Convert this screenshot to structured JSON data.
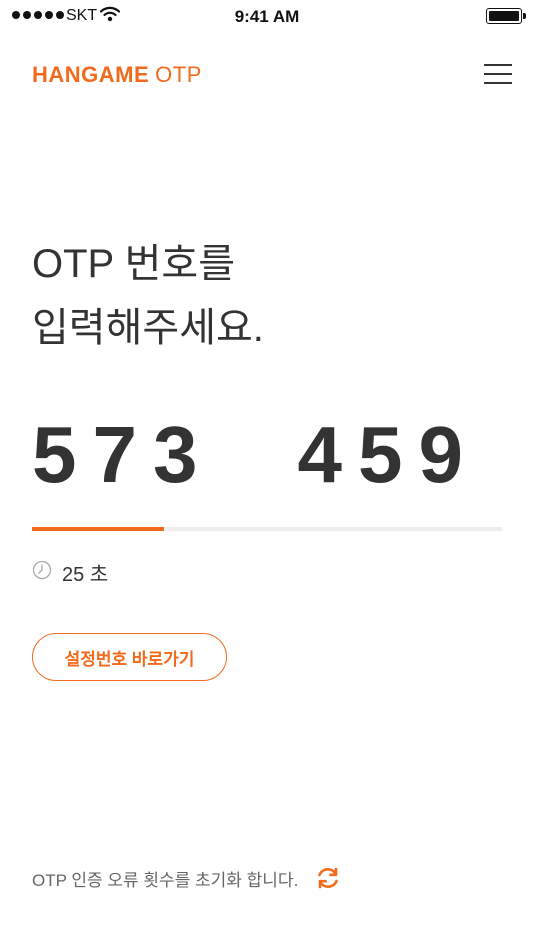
{
  "status_bar": {
    "carrier": "SKT",
    "time": "9:41 AM",
    "icons": [
      "signal-dots-icon",
      "wifi-icon",
      "battery-icon"
    ]
  },
  "header": {
    "logo_brand": "HANGAME",
    "logo_suffix": "OTP",
    "menu_icon": "hamburger-menu-icon"
  },
  "main": {
    "title_line1": "OTP 번호를",
    "title_line2": "입력해주세요.",
    "otp_part1": "573",
    "otp_part2": "459",
    "progress_fraction": 0.28,
    "timer_text": "25 초",
    "settings_button_label": "설정번호 바로가기"
  },
  "footer": {
    "reset_text": "OTP 인증 오류 횟수를 초기화 합니다.",
    "reset_icon": "refresh-icon"
  },
  "colors": {
    "accent": "#f26a1b",
    "text": "#333333",
    "muted": "#666666",
    "track": "#eeeeee"
  }
}
